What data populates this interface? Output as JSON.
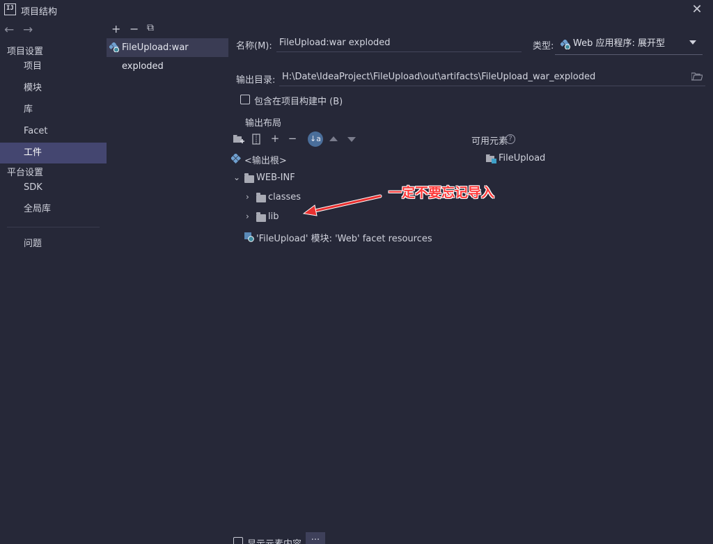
{
  "window": {
    "logo": "IJ",
    "title": "项目结构",
    "close_glyph": "✕"
  },
  "nav": {
    "back_glyph": "←",
    "forward_glyph": "→"
  },
  "sidebar": {
    "section_project": "项目设置",
    "items": [
      {
        "label": "项目"
      },
      {
        "label": "模块"
      },
      {
        "label": "库"
      },
      {
        "label": "Facet"
      },
      {
        "label": "工件",
        "selected": true
      }
    ],
    "section_platform": "平台设置",
    "platform_items": [
      {
        "label": "SDK"
      },
      {
        "label": "全局库"
      }
    ],
    "problems": "问题"
  },
  "artifacts_toolbar": {
    "add": "+",
    "remove": "−",
    "copy": "⧉"
  },
  "artifacts": [
    {
      "name": "FileUpload:war exploded"
    }
  ],
  "form": {
    "name_label": "名称(M):",
    "name_value": "FileUpload:war exploded",
    "type_label": "类型:",
    "type_value": "Web 应用程序: 展开型",
    "output_dir_label": "输出目录:",
    "output_dir_value": "H:\\Date\\IdeaProject\\FileUpload\\out\\artifacts\\FileUpload_war_exploded",
    "include_in_build": "包含在项目构建中 (B)",
    "output_layout_title": "输出布局",
    "available_elements": "可用元素",
    "help_glyph": "?",
    "show_content": "显示元素内容",
    "more": "..."
  },
  "layout_toolbar": {
    "add": "+",
    "remove": "−",
    "sort": "↓a"
  },
  "tree": {
    "root": "<输出根>",
    "web_inf": "WEB-INF",
    "classes": "classes",
    "lib": "lib",
    "facet_resources": "'FileUpload' 模块: 'Web' facet resources"
  },
  "available_tree": {
    "module": "FileUpload"
  },
  "annotation": {
    "text": "一定不要忘记导入",
    "color": "#ff3b3b"
  },
  "colors": {
    "background": "#262838",
    "selection": "#444670",
    "artifact_selection": "#3a3c54",
    "accent_blue": "#4a6e9a"
  }
}
